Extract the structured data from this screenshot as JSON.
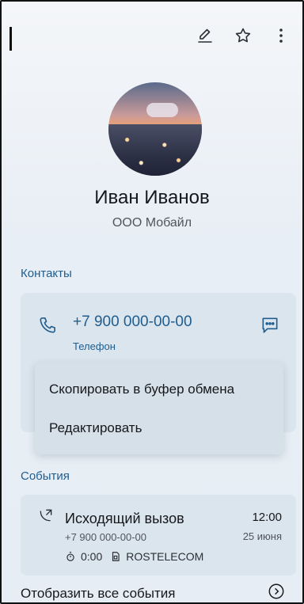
{
  "header": {
    "icons": [
      "edit-icon",
      "star-icon",
      "more-vert-icon"
    ]
  },
  "profile": {
    "name": "Иван Иванов",
    "company": "ООО Мобайл"
  },
  "contacts": {
    "section_title": "Контакты",
    "phone_number": "+7 900 000-00-00",
    "phone_label": "Телефон"
  },
  "context_menu": {
    "items": [
      "Скопировать в буфер обмена",
      "Редактировать"
    ]
  },
  "events": {
    "section_title": "События",
    "event": {
      "title": "Исходящий вызов",
      "phone": "+7 900 000-00-00",
      "time": "12:00",
      "date": "25 июня",
      "duration": "0:00",
      "sim": "ROSTELECOM"
    },
    "show_all": "Отобразить все события"
  }
}
